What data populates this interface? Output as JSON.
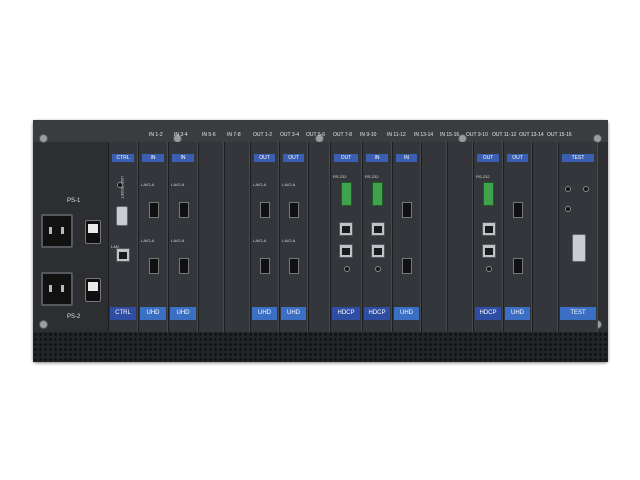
{
  "device": {
    "power_supply_labels": [
      "PS-1",
      "PS-2"
    ],
    "slot_labels": [
      "IN 1-2",
      "IN 3-4",
      "IN 5-6",
      "IN 7-8",
      "OUT 1-2",
      "OUT 3-4",
      "OUT 5-6",
      "OUT 7-8",
      "IN 9-10",
      "IN 11-12",
      "IN 13-14",
      "IN 15-16",
      "OUT 9-10",
      "OUT 11-12",
      "OUT 13-14",
      "OUT 15-16"
    ],
    "card_headers": [
      "CTRL",
      "IN",
      "IN",
      "OUT",
      "OUT",
      "OUT",
      "IN",
      "IN",
      "OUT",
      "OUT",
      "TEST"
    ],
    "card_footers": [
      "CTRL",
      "UHD",
      "UHD",
      "UHD",
      "UHD",
      "HDCP",
      "HDCP",
      "UHD",
      "HDCP",
      "UHD",
      "TEST"
    ],
    "port_labels": {
      "in_a": "I-A/O-A",
      "out_a": "I-A/O-A",
      "a": "A",
      "rs232": "RS-232",
      "hdbt_a": "HDBT-A",
      "hdbt_b": "HDBT-B",
      "ir_a": "IR-A",
      "ir_b": "IR-B",
      "usb_reset": "USB RESET",
      "lan_ethernet": "LAN"
    },
    "colors": {
      "chassis": "#2c2e31",
      "label_blue": "#2f4ea3",
      "header_blue": "#3a5fb0",
      "terminal_green": "#3fa34d"
    }
  }
}
